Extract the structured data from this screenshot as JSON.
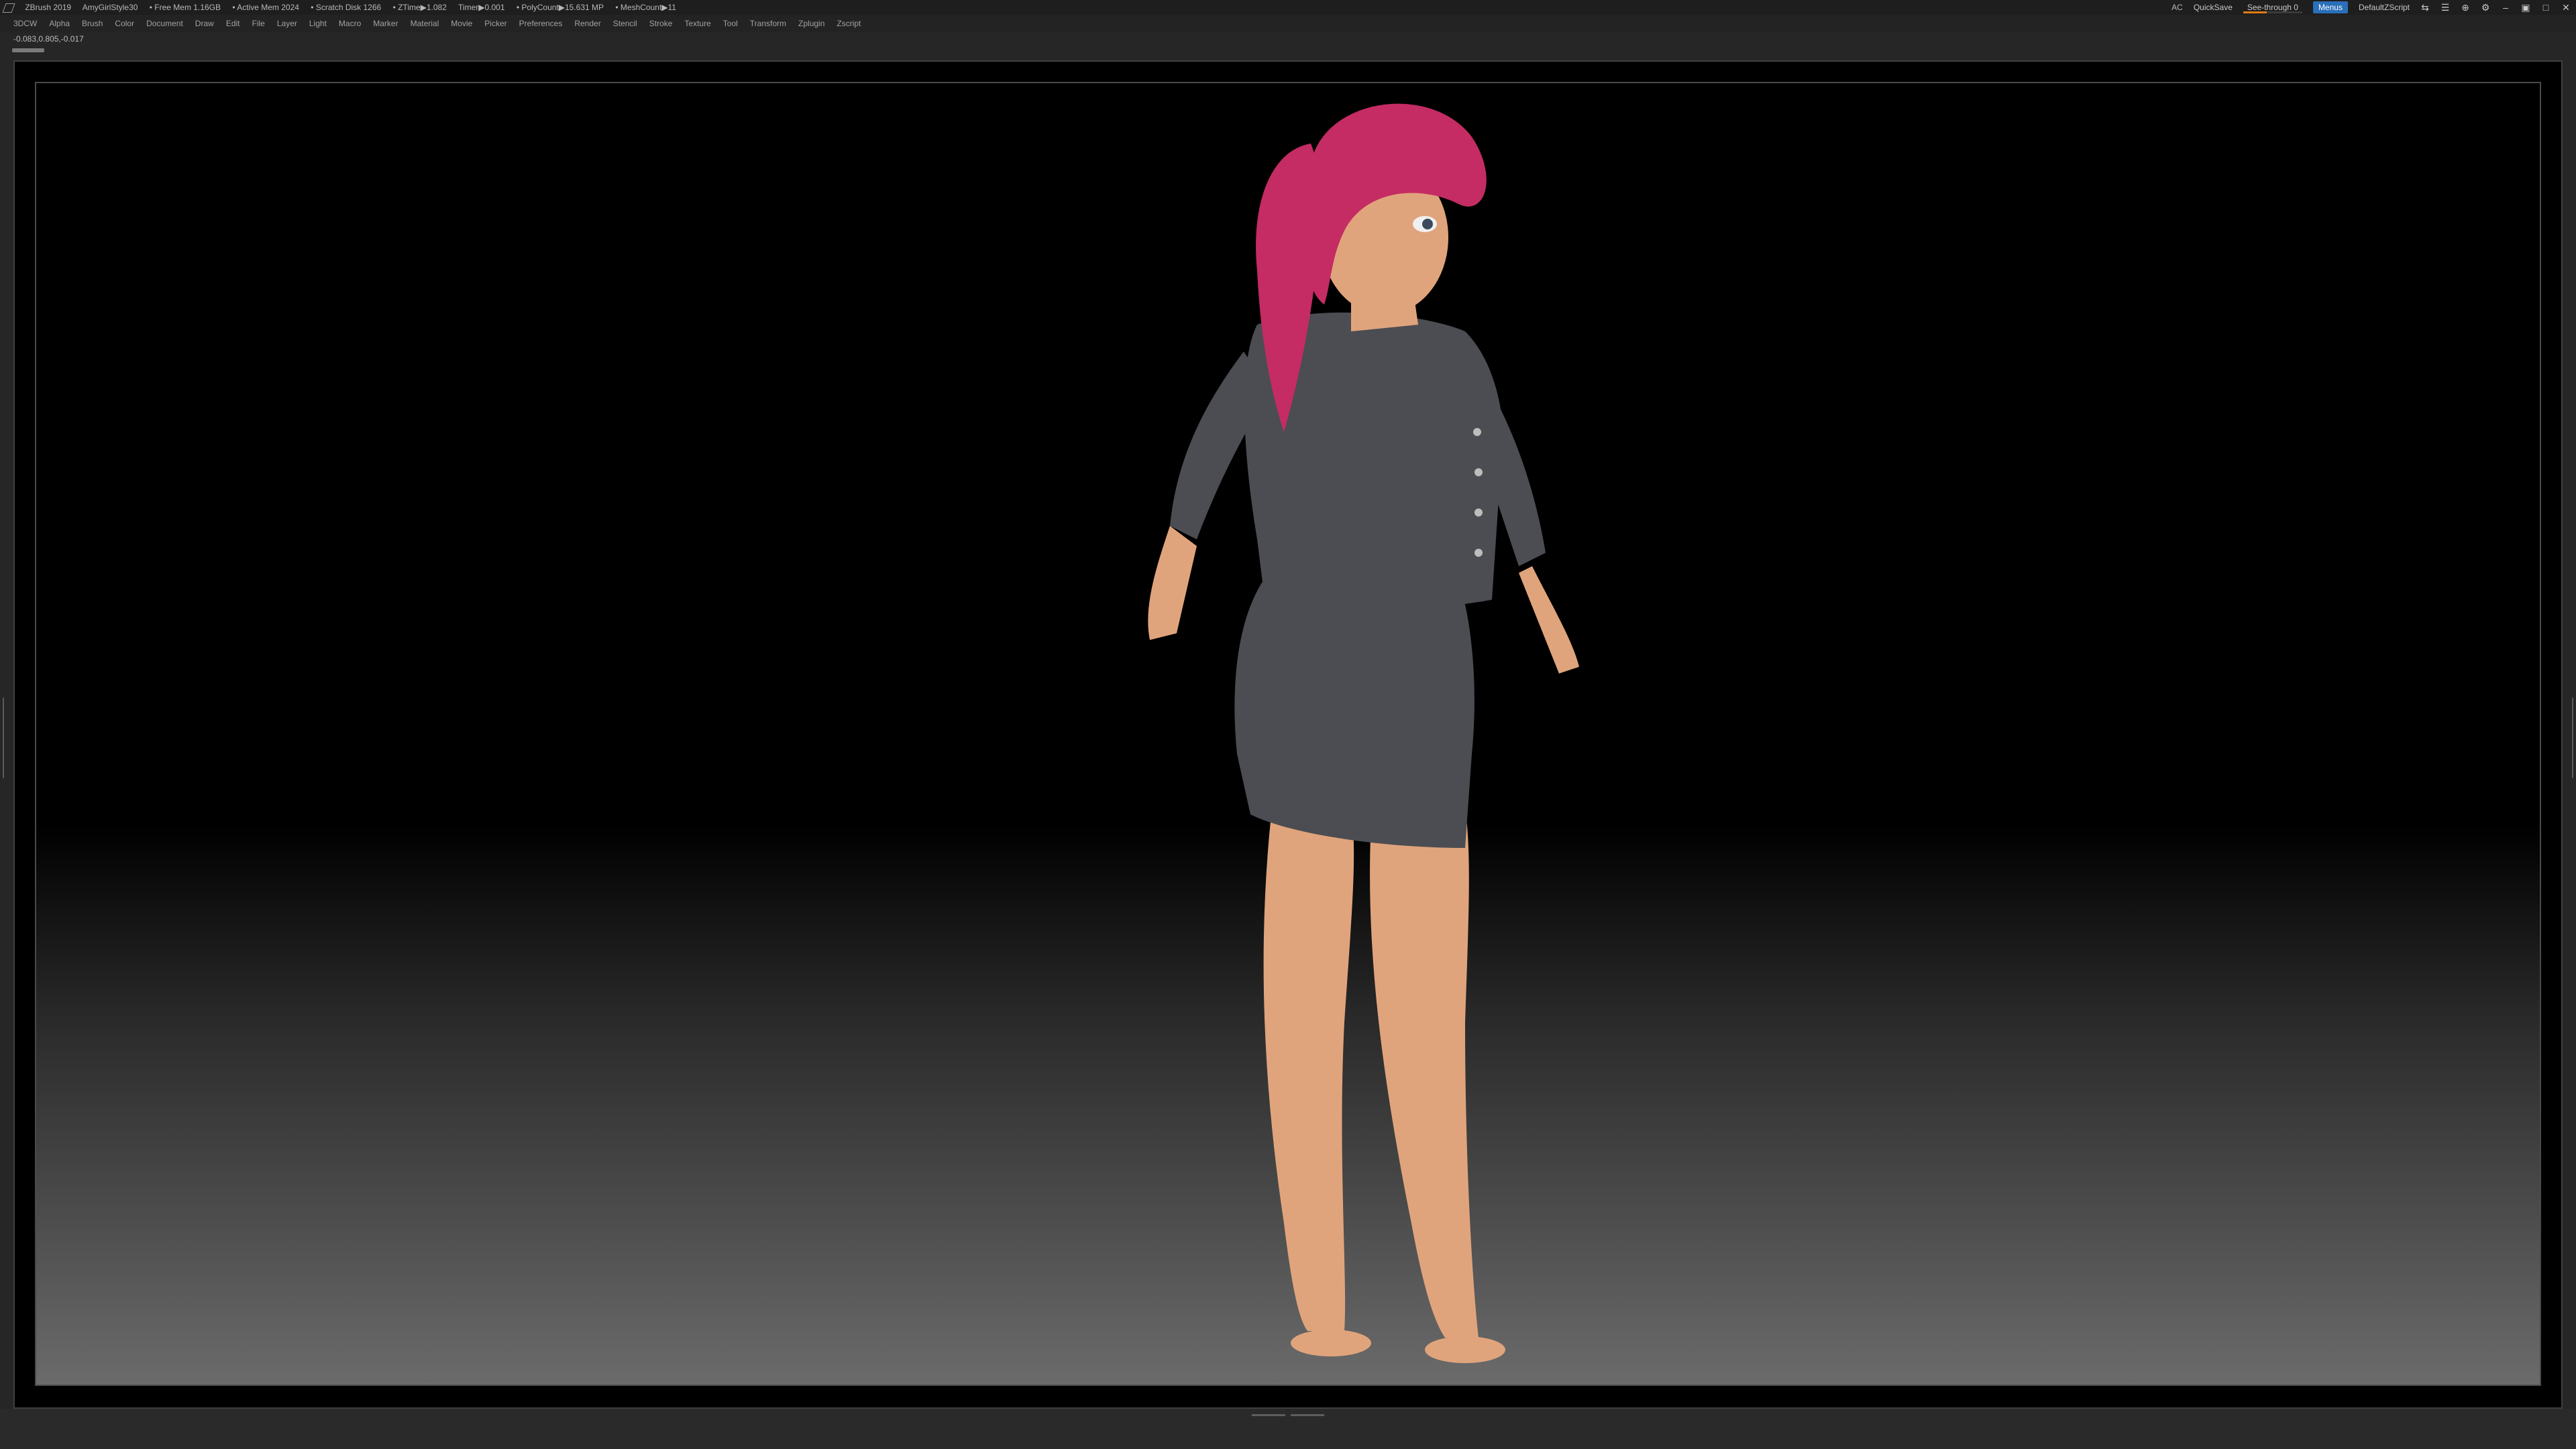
{
  "titlebar": {
    "app": "ZBrush 2019",
    "document": "AmyGirlStyle30",
    "free_mem": "• Free Mem 1.16GB",
    "active_mem": "• Active Mem 2024",
    "scratch": "• Scratch Disk 1266",
    "ztime": "• ZTime▶1.082",
    "timer": "Timer▶0.001",
    "polycount": "• PolyCount▶15.631 MP",
    "meshcount": "• MeshCount▶11",
    "ac": "AC",
    "quicksave": "QuickSave",
    "see_through": "See-through 0",
    "see_through_value": 0.4,
    "menus": "Menus",
    "default_script": "DefaultZScript"
  },
  "menubar": {
    "items": [
      "3DCW",
      "Alpha",
      "Brush",
      "Color",
      "Document",
      "Draw",
      "Edit",
      "File",
      "Layer",
      "Light",
      "Macro",
      "Marker",
      "Material",
      "Movie",
      "Picker",
      "Preferences",
      "Render",
      "Stencil",
      "Stroke",
      "Texture",
      "Tool",
      "Transform",
      "Zplugin",
      "Zscript"
    ]
  },
  "coords": "-0.083,0.805,-0.017",
  "colors": {
    "accent": "#2a6fb9",
    "hair": "#c42c63",
    "skin": "#e0a47c",
    "cloth": "#4b4d52"
  }
}
